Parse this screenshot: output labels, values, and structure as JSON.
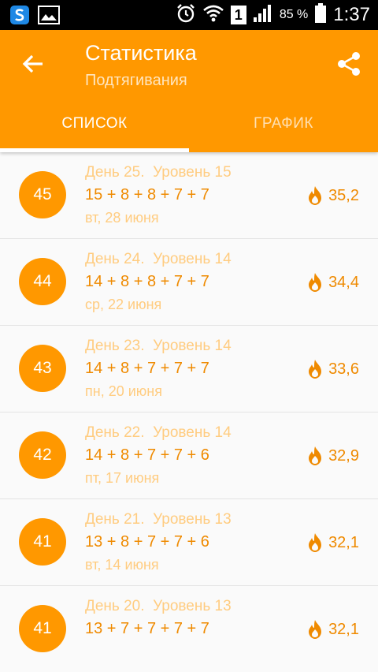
{
  "status_bar": {
    "battery_percent": "85 %",
    "sim_slot": "1",
    "time": "1:37"
  },
  "header": {
    "title": "Статистика",
    "subtitle": "Подтягивания",
    "tabs": [
      "СПИСОК",
      "ГРАФИК"
    ],
    "active_tab": 0
  },
  "colors": {
    "accent": "#ff9800",
    "accent_dark": "#ef8a00",
    "accent_light": "#ffcc80"
  },
  "entries": [
    {
      "number": "45",
      "day_level": "День 25.  Уровень 15",
      "reps": "15 + 8 + 8 + 7 + 7",
      "date": "вт, 28 июня",
      "kcal": "35,2"
    },
    {
      "number": "44",
      "day_level": "День 24.  Уровень 14",
      "reps": "14 + 8 + 8 + 7 + 7",
      "date": "ср, 22 июня",
      "kcal": "34,4"
    },
    {
      "number": "43",
      "day_level": "День 23.  Уровень 14",
      "reps": "14 + 8 + 7 + 7 + 7",
      "date": "пн, 20 июня",
      "kcal": "33,6"
    },
    {
      "number": "42",
      "day_level": "День 22.  Уровень 14",
      "reps": "14 + 8 + 7 + 7 + 6",
      "date": "пт, 17 июня",
      "kcal": "32,9"
    },
    {
      "number": "41",
      "day_level": "День 21.  Уровень 13",
      "reps": "13 + 8 + 7 + 7 + 6",
      "date": "вт, 14 июня",
      "kcal": "32,1"
    },
    {
      "number": "41",
      "day_level": "День 20.  Уровень 13",
      "reps": "13 + 7 + 7 + 7 + 7",
      "date": "",
      "kcal": "32,1"
    }
  ]
}
